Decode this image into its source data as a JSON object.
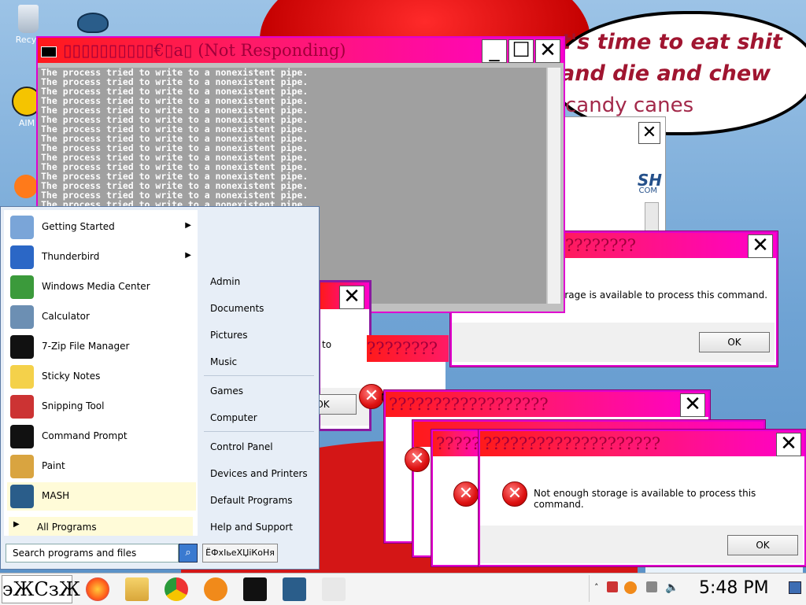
{
  "desktop": {
    "icons": [
      {
        "label": "Recyc",
        "icon": "recycle-bin-icon"
      },
      {
        "label": "AIM",
        "icon": "aim-icon"
      }
    ],
    "bubble_lines": [
      "t's time to eat shit",
      "and die and chew",
      "candy canes"
    ]
  },
  "cmd_window": {
    "title": "▯▯▯▯▯▯▯▯▯▯€▯a▯ (Not Responding)",
    "line_text": "The process tried to write to a nonexistent pipe.",
    "lines_count": 23
  },
  "dialogs": {
    "main_title": "????????",
    "main_message": "Not enough storage is available to process this command.",
    "partial_message": "orage is available to process this command.",
    "mid_title": "??????????????????",
    "front_title": "????????????????????",
    "back_title": "????????",
    "ok_label": "OK",
    "ok_partial": "OK",
    "to_fragment": "to",
    "n_fragment": "N",
    "mash_fragment": "SH",
    "com_fragment": "COM"
  },
  "start_menu": {
    "left_items": [
      {
        "label": "Getting Started",
        "icon": "getting-started-icon",
        "arrow": true
      },
      {
        "label": "Thunderbird",
        "icon": "thunderbird-icon",
        "arrow": true
      },
      {
        "label": "Windows Media Center",
        "icon": "media-center-icon",
        "arrow": false
      },
      {
        "label": "Calculator",
        "icon": "calculator-icon",
        "arrow": false
      },
      {
        "label": "7-Zip File Manager",
        "icon": "7zip-icon",
        "arrow": false
      },
      {
        "label": "Sticky Notes",
        "icon": "sticky-notes-icon",
        "arrow": false
      },
      {
        "label": "Snipping Tool",
        "icon": "snipping-tool-icon",
        "arrow": false
      },
      {
        "label": "Command Prompt",
        "icon": "command-prompt-icon",
        "arrow": false
      },
      {
        "label": "Paint",
        "icon": "paint-icon",
        "arrow": false
      },
      {
        "label": "MASH",
        "icon": "mash-icon",
        "arrow": false
      }
    ],
    "all_programs": "All Programs",
    "right_items": [
      "Admin",
      "Documents",
      "Pictures",
      "Music",
      "Games",
      "Computer",
      "Control Panel",
      "Devices and Printers",
      "Default Programs",
      "Help and Support"
    ],
    "search_placeholder": "Search programs and files",
    "shutdown_label": "ЁФхІьеХЏіКоНя"
  },
  "taskbar": {
    "start_label": "эЖСзЖ",
    "apps": [
      "firefox-icon",
      "explorer-icon",
      "chrome-icon",
      "avast-icon",
      "command-prompt-icon",
      "mash-icon",
      "window-icon"
    ],
    "clock": "5:48 PM"
  }
}
